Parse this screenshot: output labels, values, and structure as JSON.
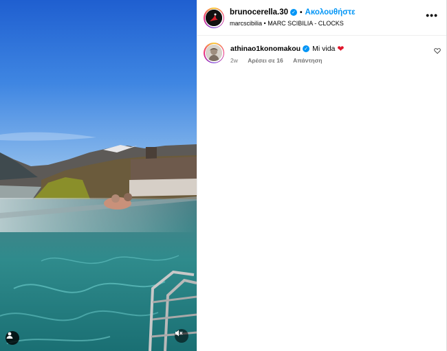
{
  "post": {
    "author": "brunocerella.30",
    "follow_label": "Ακολουθήστε",
    "audio_artist": "marcscibilia",
    "audio_track": "MARC SCIBILIA - CLOCKS",
    "more_label": "•••"
  },
  "comments": [
    {
      "user": "athinao1konomakou",
      "text": "Mi vida",
      "emoji": "❤",
      "age": "2w",
      "likes_label": "Αρέσει σε 16",
      "reply_label": "Απάντηση"
    }
  ],
  "icons": {
    "verified": "verified-badge-icon",
    "like": "heart-outline-icon",
    "mute": "speaker-muted-icon",
    "tagged_user": "user-tag-icon"
  },
  "colors": {
    "accent": "#0095f6",
    "heart": "#e0162b",
    "meta_gray": "#737373"
  }
}
